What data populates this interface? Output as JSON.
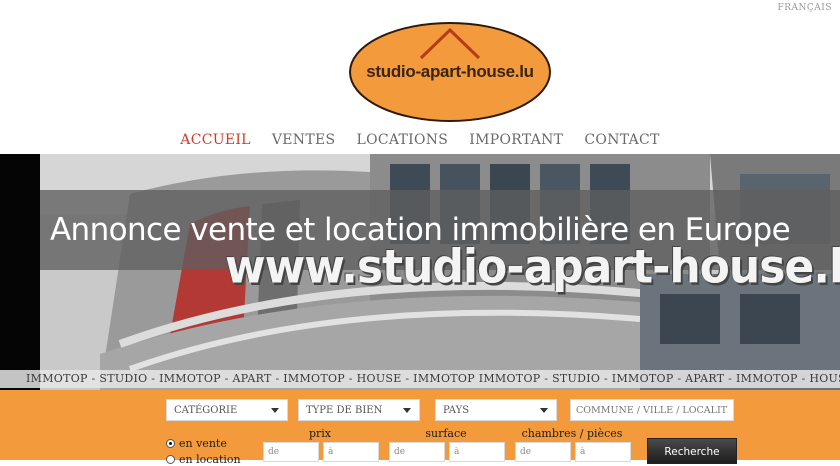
{
  "header": {
    "language": "FRANÇAIS",
    "logo_text": "studio-apart-house.lu"
  },
  "nav": {
    "items": [
      {
        "label": "ACCUEIL"
      },
      {
        "label": "VENTES"
      },
      {
        "label": "LOCATIONS"
      },
      {
        "label": "IMPORTANT"
      },
      {
        "label": "CONTACT"
      }
    ]
  },
  "banner": {
    "tagline": "Annonce vente et location immobilière en Europe",
    "watermark": "www.studio-apart-house.lu",
    "ticker": "IMMOTOP - STUDIO - IMMOTOP - APART - IMMOTOP - HOUSE - IMMOTOP IMMOTOP - STUDIO - IMMOTOP - APART - IMMOTOP - HOUSE - IMMOTOP"
  },
  "search": {
    "category_label": "CATÉGORIE",
    "property_type_label": "TYPE DE BIEN",
    "country_label": "PAYS",
    "location_placeholder": "COMMUNE / VILLE / LOCALITÉ",
    "mode_sale": "en vente",
    "mode_rent": "en location",
    "price_label": "prix",
    "surface_label": "surface",
    "rooms_label": "chambres / pièces",
    "from_placeholder": "de",
    "to_placeholder": "à",
    "submit_label": "Recherche"
  },
  "colors": {
    "accent_orange": "#f39a3c",
    "nav_active": "#d13a26",
    "logo_fill": "#f39a3c",
    "logo_roof": "#b83a1c"
  }
}
